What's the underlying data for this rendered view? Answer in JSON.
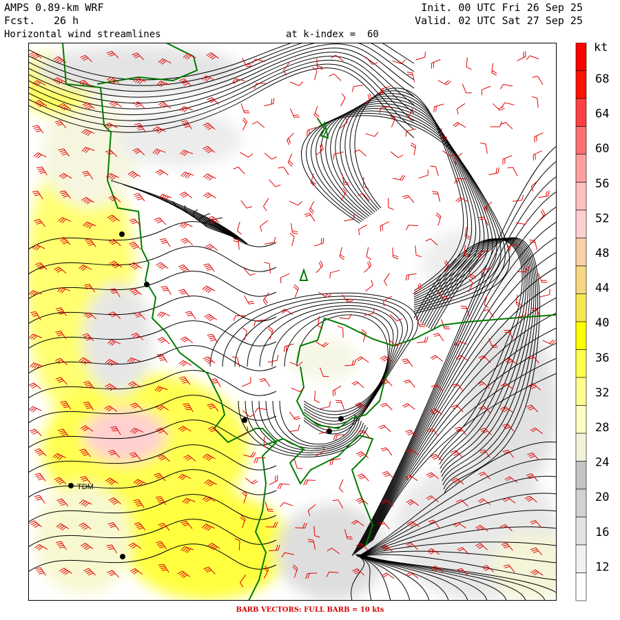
{
  "header": {
    "model": "AMPS 0.89-km WRF",
    "fcst_label": "Fcst.",
    "fcst_value": "26 h",
    "product": "Horizontal wind streamlines",
    "level": "at k-index =  60",
    "init_label": "Init.",
    "init_value": "00 UTC Fri 26 Sep 25",
    "valid_label": "Valid.",
    "valid_value": "02 UTC Sat 27 Sep 25"
  },
  "colorbar": {
    "unit": "kt",
    "labels": [
      "68",
      "64",
      "60",
      "56",
      "52",
      "48",
      "44",
      "40",
      "36",
      "32",
      "28",
      "24",
      "20",
      "16",
      "12"
    ],
    "colors": [
      "#ffffff",
      "#f2f2f2",
      "#e3e3e3",
      "#d2d2d2",
      "#c4c4c4",
      "#f3f3dc",
      "#ffffc0",
      "#ffff90",
      "#ffff50",
      "#ffff00",
      "#f8e850",
      "#f7d784",
      "#fcd0a8",
      "#ffd0d0",
      "#ffbfbf",
      "#ffa0a0",
      "#ff7070",
      "#ff4040",
      "#ff1000",
      "#ff0000"
    ]
  },
  "map": {
    "stations": [
      {
        "label": ""
      },
      {
        "label": ""
      },
      {
        "label": ""
      },
      {
        "label": ""
      },
      {
        "label": ""
      },
      {
        "label": "TDM"
      },
      {
        "label": ""
      }
    ]
  },
  "footer": "BARB VECTORS:  FULL BARB = 10 kts"
}
